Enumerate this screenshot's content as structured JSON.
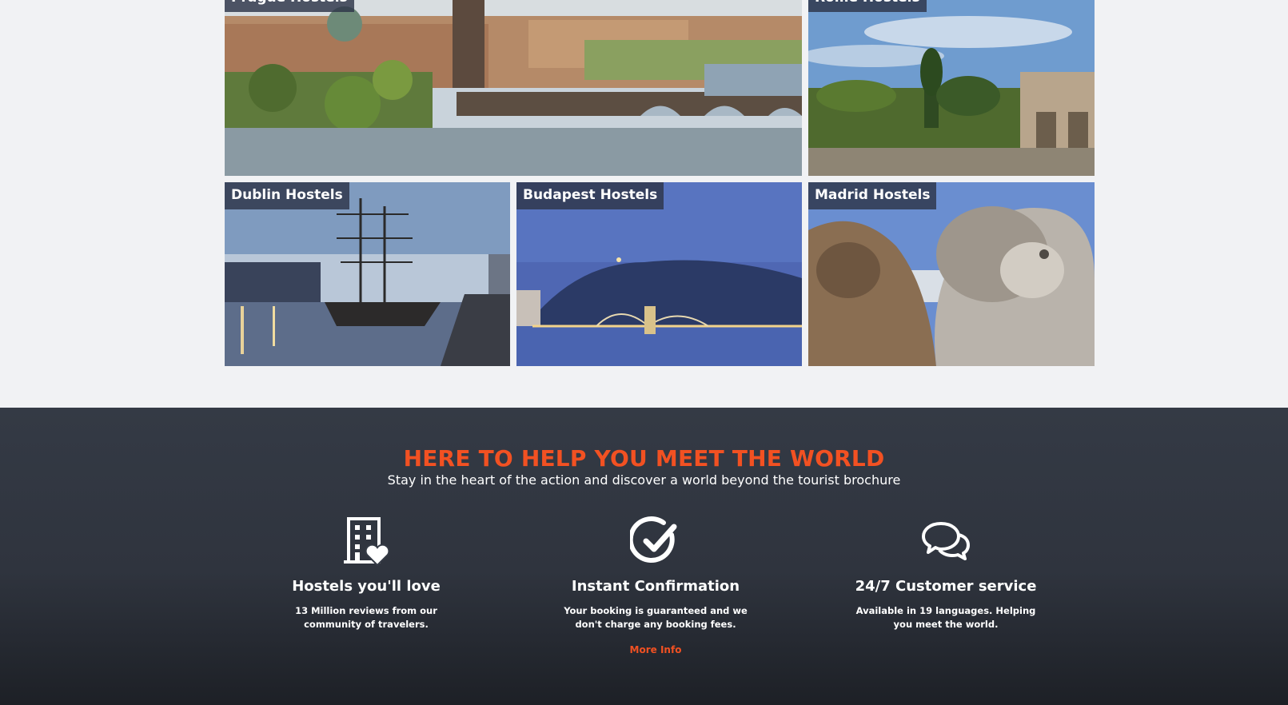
{
  "destinations": [
    {
      "label": "Prague Hostels"
    },
    {
      "label": "Rome Hostels"
    },
    {
      "label": "Dublin Hostels"
    },
    {
      "label": "Budapest Hostels"
    },
    {
      "label": "Madrid Hostels"
    }
  ],
  "footer": {
    "heading": "HERE TO HELP YOU MEET THE WORLD",
    "tagline": "Stay in the heart of the action and discover a world beyond the tourist brochure",
    "features": [
      {
        "icon": "building-heart-icon",
        "title": "Hostels you'll love",
        "description": "13 Million reviews from our community of travelers."
      },
      {
        "icon": "check-circle-icon",
        "title": "Instant Confirmation",
        "description": "Your booking is guaranteed and we don't charge any booking fees.",
        "link": "More Info"
      },
      {
        "icon": "chat-bubbles-icon",
        "title": "24/7 Customer service",
        "description": "Available in 19 languages. Helping you meet the world."
      }
    ]
  },
  "colors": {
    "accent": "#f25122",
    "footer_bg": "#343a45",
    "page_bg": "#f1f2f4",
    "label_bg": "#2d3448"
  }
}
